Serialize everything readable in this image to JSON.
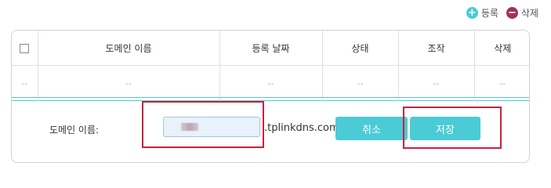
{
  "toolbar": {
    "add_label": "등록",
    "delete_label": "삭제"
  },
  "table": {
    "columns": [
      "도메인 이름",
      "등록 날짜",
      "상태",
      "조작",
      "삭제"
    ],
    "placeholder_row": [
      "--",
      "--",
      "--",
      "--",
      "--",
      "--"
    ]
  },
  "edit": {
    "domain_label": "도메인 이름:",
    "domain_suffix": ".tplinkdns.com",
    "cancel_label": "취소",
    "save_label": "저장"
  },
  "colors": {
    "accent": "#4acbd6",
    "delete_icon": "#a4305e",
    "highlight": "#c9213b"
  }
}
